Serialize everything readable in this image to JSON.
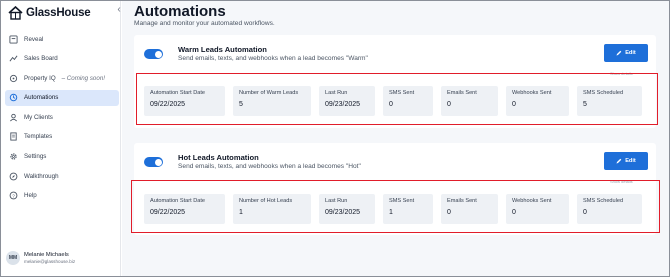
{
  "app": {
    "name": "GlassHouse",
    "collapse_icon": "chevron-left-icon"
  },
  "sidebar": {
    "items": [
      {
        "label": "Reveal",
        "icon": "reveal-icon",
        "active": false
      },
      {
        "label": "Sales Board",
        "icon": "sales-board-icon",
        "active": false
      },
      {
        "label": "Property IQ",
        "suffix": " – Coming soon!",
        "icon": "property-iq-icon",
        "active": false
      },
      {
        "label": "Automations",
        "icon": "automations-icon",
        "active": true
      },
      {
        "label": "My Clients",
        "icon": "clients-icon",
        "active": false
      },
      {
        "label": "Templates",
        "icon": "templates-icon",
        "active": false
      },
      {
        "label": "Settings",
        "icon": "gear-icon",
        "active": false
      },
      {
        "label": "Walkthrough",
        "icon": "compass-icon",
        "active": false
      },
      {
        "label": "Help",
        "icon": "help-icon",
        "active": false
      }
    ],
    "user": {
      "initials": "MM",
      "name": "Melanie Michaels",
      "email": "melanie@glasshouse.biz"
    }
  },
  "page": {
    "title": "Automations",
    "subtitle": "Manage and monitor your automated workflows."
  },
  "automations": [
    {
      "title": "Warm Leads Automation",
      "description": "Send emails, texts, and webhooks when a lead becomes \"Warm\"",
      "enabled": true,
      "edit_label": "Edit",
      "details_label": "Show details",
      "stats": [
        {
          "label": "Automation Start Date",
          "value": "09/22/2025"
        },
        {
          "label": "Number of Warm Leads",
          "value": "5"
        },
        {
          "label": "Last Run",
          "value": "09/23/2025"
        },
        {
          "label": "SMS Sent",
          "value": "0"
        },
        {
          "label": "Emails Sent",
          "value": "0"
        },
        {
          "label": "Webhooks Sent",
          "value": "0"
        },
        {
          "label": "SMS Scheduled",
          "value": "5"
        }
      ]
    },
    {
      "title": "Hot Leads Automation",
      "description": "Send emails, texts, and webhooks when a lead becomes \"Hot\"",
      "enabled": true,
      "edit_label": "Edit",
      "details_label": "Show details",
      "stats": [
        {
          "label": "Automation Start Date",
          "value": "09/22/2025"
        },
        {
          "label": "Number of Hot Leads",
          "value": "1"
        },
        {
          "label": "Last Run",
          "value": "09/23/2025"
        },
        {
          "label": "SMS Sent",
          "value": "1"
        },
        {
          "label": "Emails Sent",
          "value": "0"
        },
        {
          "label": "Webhooks Sent",
          "value": "0"
        },
        {
          "label": "SMS Scheduled",
          "value": "0"
        }
      ]
    }
  ],
  "colors": {
    "accent": "#1e6fd9",
    "highlight": "#e11d2a",
    "active_nav": "#dbe7fb"
  }
}
